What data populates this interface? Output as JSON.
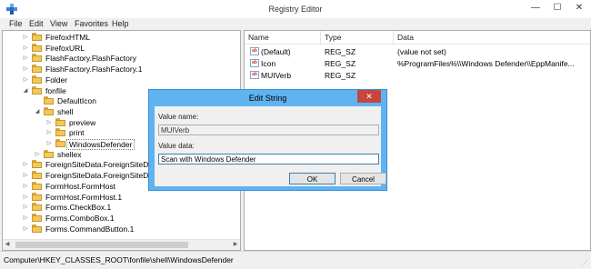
{
  "window": {
    "title": "Registry Editor",
    "buttons": {
      "minimize": "—",
      "maximize": "☐",
      "close": "✕"
    }
  },
  "menu": [
    "File",
    "Edit",
    "View",
    "Favorites",
    "Help"
  ],
  "tree": [
    {
      "label": "FirefoxHTML",
      "indent": 0,
      "expander": "collapsed"
    },
    {
      "label": "FirefoxURL",
      "indent": 0,
      "expander": "collapsed"
    },
    {
      "label": "FlashFactory.FlashFactory",
      "indent": 0,
      "expander": "collapsed"
    },
    {
      "label": "FlashFactory.FlashFactory.1",
      "indent": 0,
      "expander": "collapsed"
    },
    {
      "label": "Folder",
      "indent": 0,
      "expander": "collapsed"
    },
    {
      "label": "fonfile",
      "indent": 0,
      "expander": "expanded"
    },
    {
      "label": "DefaultIcon",
      "indent": 1,
      "expander": "none"
    },
    {
      "label": "shell",
      "indent": 1,
      "expander": "expanded"
    },
    {
      "label": "preview",
      "indent": 2,
      "expander": "collapsed"
    },
    {
      "label": "print",
      "indent": 2,
      "expander": "collapsed"
    },
    {
      "label": "WindowsDefender",
      "indent": 2,
      "expander": "collapsed",
      "selected": true
    },
    {
      "label": "shellex",
      "indent": 1,
      "expander": "collapsed"
    },
    {
      "label": "ForeignSiteData.ForeignSiteD",
      "indent": 0,
      "expander": "collapsed"
    },
    {
      "label": "ForeignSiteData.ForeignSiteD",
      "indent": 0,
      "expander": "collapsed"
    },
    {
      "label": "FormHost.FormHost",
      "indent": 0,
      "expander": "collapsed"
    },
    {
      "label": "FormHost.FormHost.1",
      "indent": 0,
      "expander": "collapsed"
    },
    {
      "label": "Forms.CheckBox.1",
      "indent": 0,
      "expander": "collapsed"
    },
    {
      "label": "Forms.ComboBox.1",
      "indent": 0,
      "expander": "collapsed"
    },
    {
      "label": "Forms.CommandButton.1",
      "indent": 0,
      "expander": "collapsed"
    }
  ],
  "list": {
    "columns": [
      "Name",
      "Type",
      "Data"
    ],
    "rows": [
      {
        "name": "(Default)",
        "type": "REG_SZ",
        "data": "(value not set)",
        "icon": "string-value-icon"
      },
      {
        "name": "Icon",
        "type": "REG_SZ",
        "data": "%ProgramFiles%\\\\Windows Defender\\\\EppManife...",
        "icon": "string-value-icon"
      },
      {
        "name": "MUIVerb",
        "type": "REG_SZ",
        "data": "",
        "icon": "string-value-icon"
      }
    ]
  },
  "status": {
    "path": "Computer\\HKEY_CLASSES_ROOT\\fonfile\\shell\\WindowsDefender"
  },
  "dialog": {
    "title": "Edit String",
    "close": "✕",
    "value_name_label": "Value name:",
    "value_name": "MUIVerb",
    "value_data_label": "Value data:",
    "value_data": "Scan with Windows Defender",
    "ok_label": "OK",
    "cancel_label": "Cancel"
  },
  "colors": {
    "dialog_frame": "#5fb3f0",
    "close_button": "#c7463c",
    "folder": "#f3c85a"
  }
}
